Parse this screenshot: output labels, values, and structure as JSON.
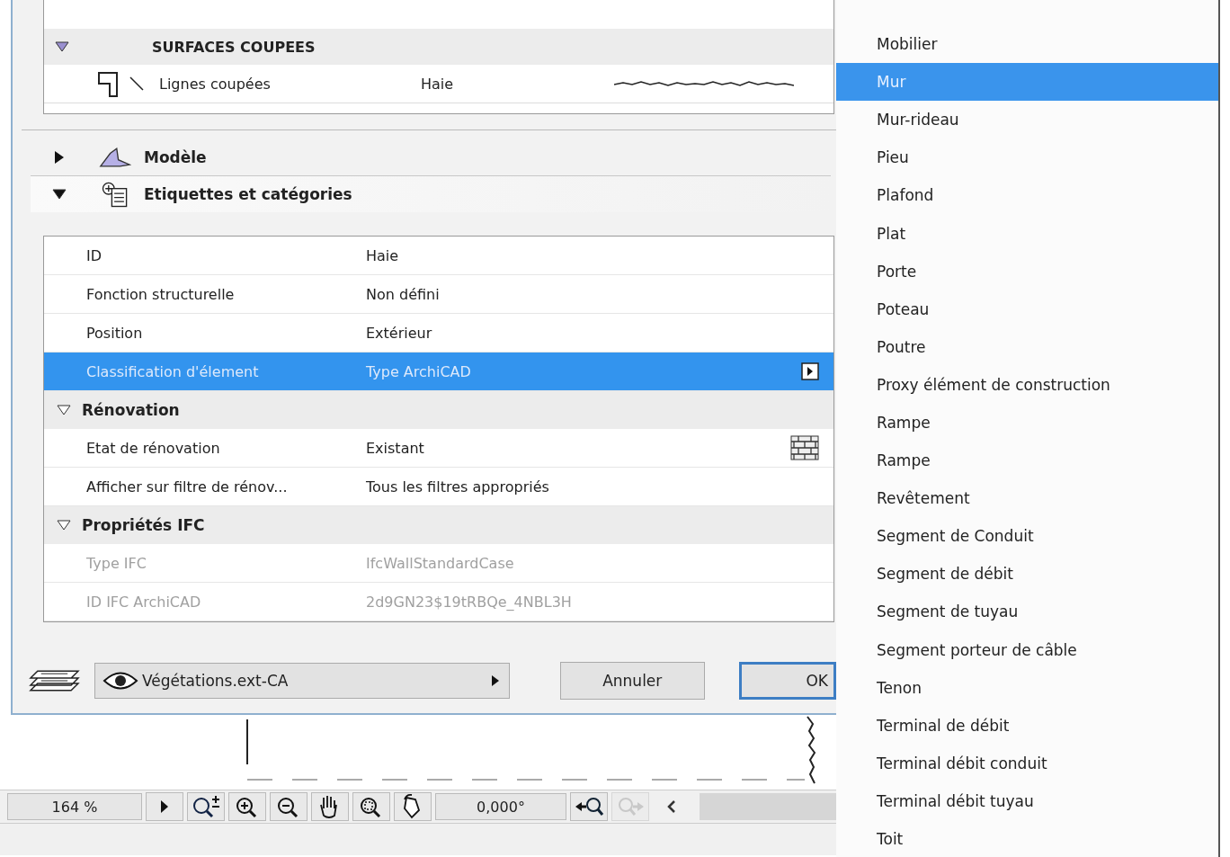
{
  "surfaces": {
    "title": "SURFACES COUPEES",
    "expanded": true,
    "rows": [
      {
        "kind": "line-sample",
        "label": "Lignes coupées",
        "value": "Haie"
      }
    ]
  },
  "panels": [
    {
      "title": "Modèle",
      "expanded": false,
      "kind": "model"
    },
    {
      "title": "Etiquettes et catégories",
      "expanded": true,
      "kind": "tags"
    }
  ],
  "table": {
    "rows": [
      {
        "kind": "text",
        "label": "ID",
        "value": "Haie",
        "selected": false,
        "disabled": false
      },
      {
        "kind": "text",
        "label": "Fonction structurelle",
        "value": "Non défini",
        "selected": false,
        "disabled": false
      },
      {
        "kind": "text",
        "label": "Position",
        "value": "Extérieur",
        "selected": false,
        "disabled": false
      },
      {
        "kind": "picker",
        "label": "Classification d'élement",
        "value": "Type ArchiCAD",
        "selected": true,
        "disabled": false
      },
      {
        "kind": "group",
        "label": "Rénovation",
        "expanded": true
      },
      {
        "kind": "pattern",
        "label": "Etat de rénovation",
        "value": "Existant",
        "selected": false,
        "disabled": false
      },
      {
        "kind": "text",
        "label": "Afficher sur filtre de rénov...",
        "value": "Tous les filtres appropriés",
        "selected": false,
        "disabled": false
      },
      {
        "kind": "group",
        "label": "Propriétés IFC",
        "expanded": true
      },
      {
        "kind": "text",
        "label": "Type IFC",
        "value": "IfcWallStandardCase",
        "selected": false,
        "disabled": true
      },
      {
        "kind": "text",
        "label": "ID IFC ArchiCAD",
        "value": "2d9GN23$19tRBQe_4NBL3H",
        "selected": false,
        "disabled": true
      }
    ]
  },
  "layer": {
    "value": "Végétations.ext-CA"
  },
  "buttons": [
    {
      "label": "Annuler",
      "default": false
    },
    {
      "label": "OK",
      "default": true
    }
  ],
  "status_bar": {
    "zoom": "164 %",
    "angle": "0,000°",
    "tools": [
      {
        "kind": "play",
        "disabled": false
      },
      {
        "kind": "zoom-toggle",
        "disabled": false
      },
      {
        "kind": "zoom-in",
        "disabled": false
      },
      {
        "kind": "zoom-out",
        "disabled": false
      },
      {
        "kind": "pan",
        "disabled": false
      },
      {
        "kind": "fit",
        "disabled": false
      },
      {
        "kind": "rotate",
        "disabled": false
      },
      {
        "kind": "back",
        "disabled": false
      },
      {
        "kind": "forward",
        "disabled": true
      },
      {
        "kind": "scroll-left",
        "disabled": false
      }
    ]
  },
  "menu": {
    "items": [
      {
        "label": "Mobilier",
        "selected": false
      },
      {
        "label": "Mur",
        "selected": true
      },
      {
        "label": "Mur-rideau",
        "selected": false
      },
      {
        "label": "Pieu",
        "selected": false
      },
      {
        "label": "Plafond",
        "selected": false
      },
      {
        "label": "Plat",
        "selected": false
      },
      {
        "label": "Porte",
        "selected": false
      },
      {
        "label": "Poteau",
        "selected": false
      },
      {
        "label": "Poutre",
        "selected": false
      },
      {
        "label": "Proxy élément de construction",
        "selected": false
      },
      {
        "label": "Rampe",
        "selected": false
      },
      {
        "label": "Rampe",
        "selected": false
      },
      {
        "label": "Revêtement",
        "selected": false
      },
      {
        "label": "Segment de Conduit",
        "selected": false
      },
      {
        "label": "Segment de débit",
        "selected": false
      },
      {
        "label": "Segment de tuyau",
        "selected": false
      },
      {
        "label": "Segment porteur de câble",
        "selected": false
      },
      {
        "label": "Tenon",
        "selected": false
      },
      {
        "label": "Terminal de débit",
        "selected": false
      },
      {
        "label": "Terminal débit conduit",
        "selected": false
      },
      {
        "label": "Terminal débit tuyau",
        "selected": false
      },
      {
        "label": "Toit",
        "selected": false
      }
    ]
  }
}
